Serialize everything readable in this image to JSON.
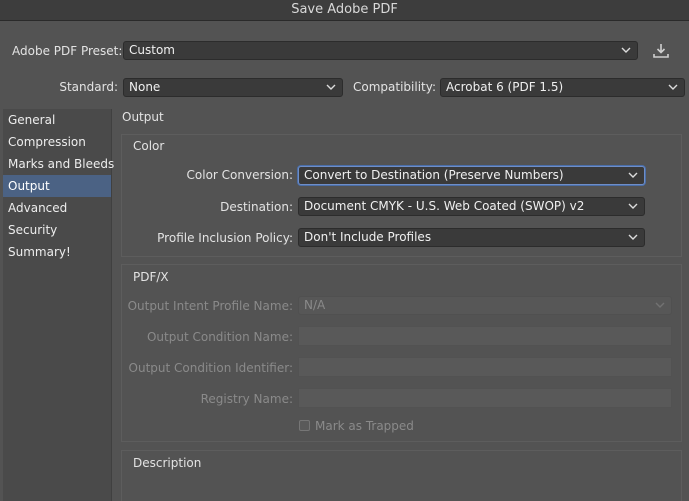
{
  "window": {
    "title": "Save Adobe PDF"
  },
  "preset": {
    "label": "Adobe PDF Preset:",
    "value": "Custom"
  },
  "standard": {
    "label": "Standard:",
    "value": "None"
  },
  "compatibility": {
    "label": "Compatibility:",
    "value": "Acrobat 6 (PDF 1.5)"
  },
  "sidebar": {
    "items": [
      {
        "label": "General"
      },
      {
        "label": "Compression"
      },
      {
        "label": "Marks and Bleeds"
      },
      {
        "label": "Output",
        "selected": true
      },
      {
        "label": "Advanced"
      },
      {
        "label": "Security"
      },
      {
        "label": "Summary!"
      }
    ]
  },
  "main": {
    "section_title": "Output",
    "color": {
      "title": "Color",
      "conversion_label": "Color Conversion:",
      "conversion_value": "Convert to Destination (Preserve Numbers)",
      "destination_label": "Destination:",
      "destination_value": "Document CMYK - U.S. Web Coated (SWOP) v2",
      "profile_label": "Profile Inclusion Policy:",
      "profile_value": "Don't Include Profiles"
    },
    "pdfx": {
      "title": "PDF/X",
      "intent_label": "Output Intent Profile Name:",
      "intent_value": "N/A",
      "condition_name_label": "Output Condition Name:",
      "condition_id_label": "Output Condition Identifier:",
      "registry_label": "Registry Name:",
      "trapped_label": "Mark as Trapped"
    },
    "description": {
      "title": "Description"
    }
  },
  "icons": {
    "save_preset": "download-preset-icon",
    "chevron": "chevron-down-icon"
  },
  "colors": {
    "selection": "#4b6284",
    "focus_ring": "#6f8ec7",
    "background": "#535353"
  }
}
